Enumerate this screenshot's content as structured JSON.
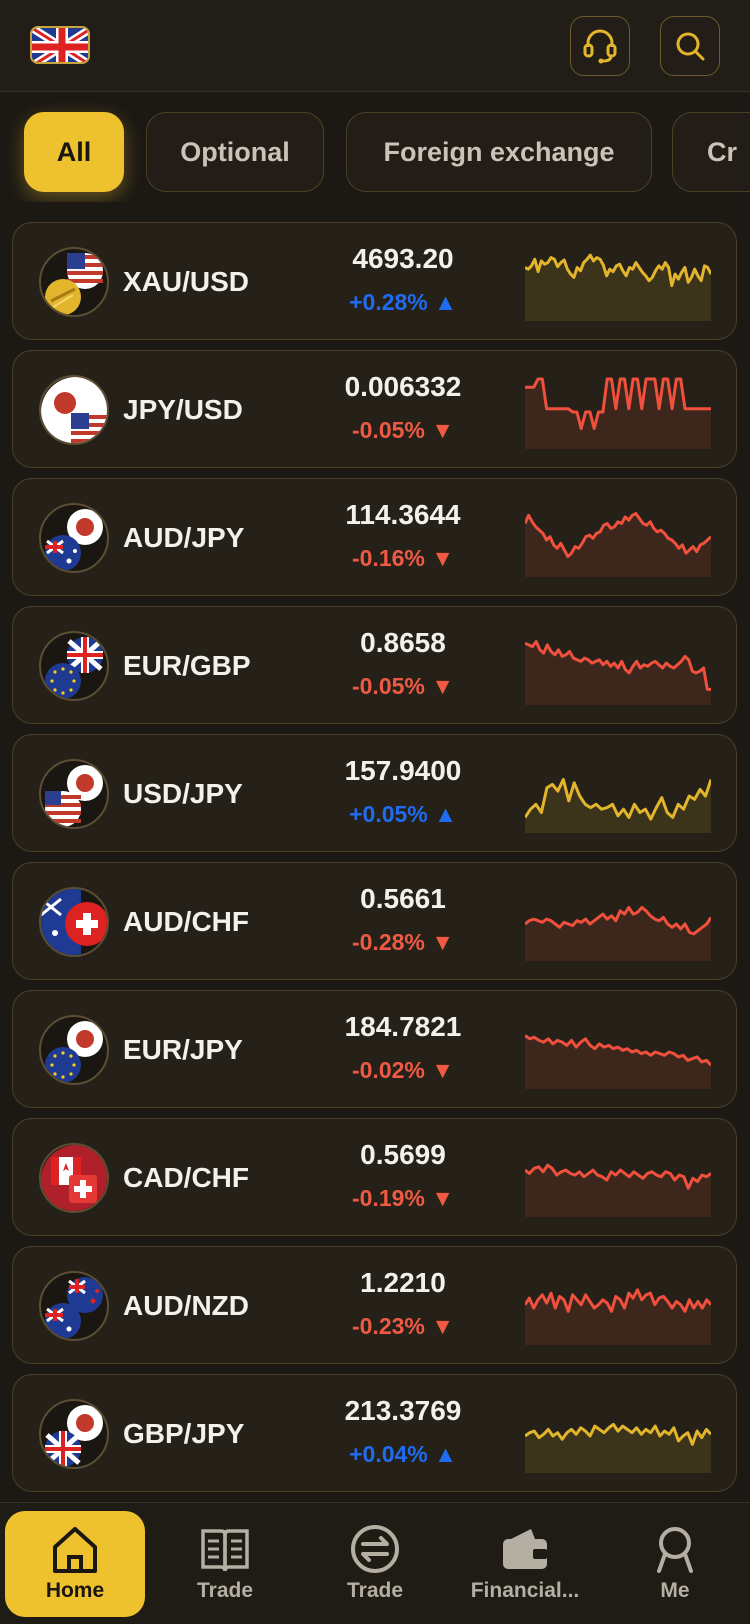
{
  "header": {
    "language_flag": "uk-flag-icon",
    "support_icon": "headset-icon",
    "search_icon": "search-icon"
  },
  "tabs": [
    {
      "label": "All",
      "active": true
    },
    {
      "label": "Optional",
      "active": false
    },
    {
      "label": "Foreign exchange",
      "active": false
    },
    {
      "label": "Cr",
      "active": false
    }
  ],
  "colors": {
    "accent": "#eec12f",
    "up": "#1f6cf0",
    "down": "#f05a45",
    "gold_line": "#e2b52c",
    "red_line": "#f0503c"
  },
  "instruments": [
    {
      "pair": "XAU/USD",
      "price": "4693.20",
      "change": "+0.28%",
      "direction": "up",
      "line_color": "gold",
      "icon": "gold-usd-icon",
      "series": [
        60,
        58,
        62,
        70,
        55,
        68,
        64,
        66,
        72,
        70,
        61,
        66,
        69,
        58,
        52,
        48,
        60,
        56,
        66,
        70,
        75,
        68,
        72,
        70,
        63,
        50,
        58,
        55,
        62,
        64,
        56,
        50,
        60,
        58,
        66,
        60,
        54,
        50,
        44,
        48,
        56,
        62,
        58,
        66,
        60,
        38,
        52,
        46,
        54,
        60,
        42,
        48,
        58,
        50,
        44,
        62,
        60,
        52
      ]
    },
    {
      "pair": "JPY/USD",
      "price": "0.006332",
      "change": "-0.05%",
      "direction": "down",
      "line_color": "red",
      "icon": "jpy-usd-icon",
      "series": [
        70,
        70,
        70,
        80,
        80,
        44,
        44,
        44,
        44,
        44,
        44,
        40,
        40,
        20,
        40,
        40,
        20,
        40,
        40,
        80,
        80,
        44,
        80,
        80,
        44,
        80,
        80,
        44,
        80,
        80,
        80,
        44,
        80,
        80,
        44,
        80,
        80,
        44,
        44,
        44,
        44,
        44,
        44,
        44
      ]
    },
    {
      "pair": "AUD/JPY",
      "price": "114.3644",
      "change": "-0.16%",
      "direction": "down",
      "line_color": "red",
      "icon": "aud-jpy-icon",
      "series": [
        60,
        70,
        62,
        56,
        52,
        48,
        40,
        44,
        34,
        30,
        36,
        28,
        20,
        24,
        32,
        30,
        36,
        44,
        46,
        42,
        48,
        50,
        58,
        60,
        54,
        56,
        62,
        60,
        68,
        64,
        70,
        72,
        66,
        60,
        58,
        62,
        54,
        50,
        52,
        48,
        42,
        40,
        36,
        30,
        34,
        24,
        28,
        32,
        26,
        34,
        36,
        40,
        44
      ]
    },
    {
      "pair": "EUR/GBP",
      "price": "0.8658",
      "change": "-0.05%",
      "direction": "down",
      "line_color": "red",
      "icon": "eur-gbp-icon",
      "series": [
        70,
        68,
        66,
        72,
        62,
        58,
        68,
        60,
        56,
        62,
        54,
        56,
        60,
        52,
        50,
        48,
        52,
        50,
        46,
        48,
        50,
        44,
        48,
        42,
        46,
        40,
        48,
        38,
        34,
        42,
        48,
        40,
        44,
        42,
        46,
        48,
        44,
        40,
        46,
        42,
        40,
        44,
        48,
        54,
        50,
        36,
        34,
        36,
        40,
        14,
        14
      ]
    },
    {
      "pair": "USD/JPY",
      "price": "157.9400",
      "change": "+0.05%",
      "direction": "up",
      "line_color": "gold",
      "icon": "usd-jpy-icon",
      "series": [
        14,
        24,
        30,
        20,
        50,
        54,
        46,
        60,
        34,
        56,
        40,
        30,
        26,
        30,
        24,
        26,
        30,
        16,
        24,
        14,
        30,
        20,
        24,
        12,
        26,
        38,
        20,
        14,
        30,
        24,
        40,
        36,
        48,
        40,
        60
      ]
    },
    {
      "pair": "AUD/CHF",
      "price": "0.5661",
      "change": "-0.28%",
      "direction": "down",
      "line_color": "red",
      "icon": "aud-chf-icon",
      "series": [
        40,
        44,
        46,
        44,
        42,
        46,
        44,
        40,
        36,
        42,
        40,
        38,
        44,
        42,
        46,
        40,
        44,
        48,
        52,
        46,
        50,
        44,
        56,
        52,
        60,
        52,
        54,
        60,
        56,
        50,
        46,
        44,
        48,
        40,
        36,
        40,
        34,
        40,
        30,
        28,
        32,
        36,
        40,
        48
      ]
    },
    {
      "pair": "EUR/JPY",
      "price": "184.7821",
      "change": "-0.02%",
      "direction": "down",
      "line_color": "red",
      "icon": "eur-jpy-icon",
      "series": [
        60,
        56,
        58,
        54,
        52,
        56,
        50,
        54,
        52,
        48,
        54,
        46,
        52,
        56,
        48,
        44,
        50,
        46,
        48,
        44,
        46,
        42,
        44,
        40,
        42,
        38,
        40,
        36,
        40,
        38,
        36,
        40,
        38,
        34,
        36,
        30,
        32,
        34,
        28,
        30,
        24
      ]
    },
    {
      "pair": "CAD/CHF",
      "price": "0.5699",
      "change": "-0.19%",
      "direction": "down",
      "line_color": "red",
      "icon": "cad-chf-icon",
      "series": [
        52,
        48,
        54,
        56,
        50,
        58,
        54,
        46,
        50,
        52,
        48,
        46,
        50,
        44,
        48,
        52,
        46,
        44,
        40,
        50,
        46,
        52,
        48,
        44,
        50,
        46,
        42,
        48,
        50,
        46,
        44,
        50,
        48,
        40,
        46,
        44,
        30,
        42,
        38,
        46,
        44,
        48
      ]
    },
    {
      "pair": "AUD/NZD",
      "price": "1.2210",
      "change": "-0.23%",
      "direction": "down",
      "line_color": "red",
      "icon": "aud-nzd-icon",
      "series": [
        44,
        52,
        40,
        50,
        56,
        46,
        58,
        40,
        54,
        50,
        36,
        56,
        50,
        44,
        56,
        48,
        40,
        44,
        50,
        46,
        36,
        54,
        50,
        40,
        58,
        52,
        62,
        50,
        56,
        58,
        44,
        52,
        54,
        48,
        40,
        48,
        44,
        36,
        50,
        40,
        48,
        40,
        50,
        44
      ]
    },
    {
      "pair": "GBP/JPY",
      "price": "213.3769",
      "change": "+0.04%",
      "direction": "up",
      "line_color": "gold",
      "icon": "gbp-jpy-icon",
      "series": [
        40,
        44,
        46,
        38,
        42,
        48,
        40,
        44,
        36,
        44,
        48,
        42,
        50,
        46,
        40,
        52,
        48,
        44,
        50,
        54,
        46,
        52,
        48,
        44,
        50,
        42,
        48,
        44,
        52,
        40,
        46,
        42,
        50,
        34,
        40,
        44,
        30,
        46,
        38,
        48,
        42
      ]
    }
  ],
  "nav": [
    {
      "label": "Home",
      "icon": "home-icon",
      "active": true
    },
    {
      "label": "Trade",
      "icon": "book-icon",
      "active": false
    },
    {
      "label": "Trade",
      "icon": "exchange-icon",
      "active": false
    },
    {
      "label": "Financial...",
      "icon": "wallet-icon",
      "active": false
    },
    {
      "label": "Me",
      "icon": "user-icon",
      "active": false
    }
  ]
}
